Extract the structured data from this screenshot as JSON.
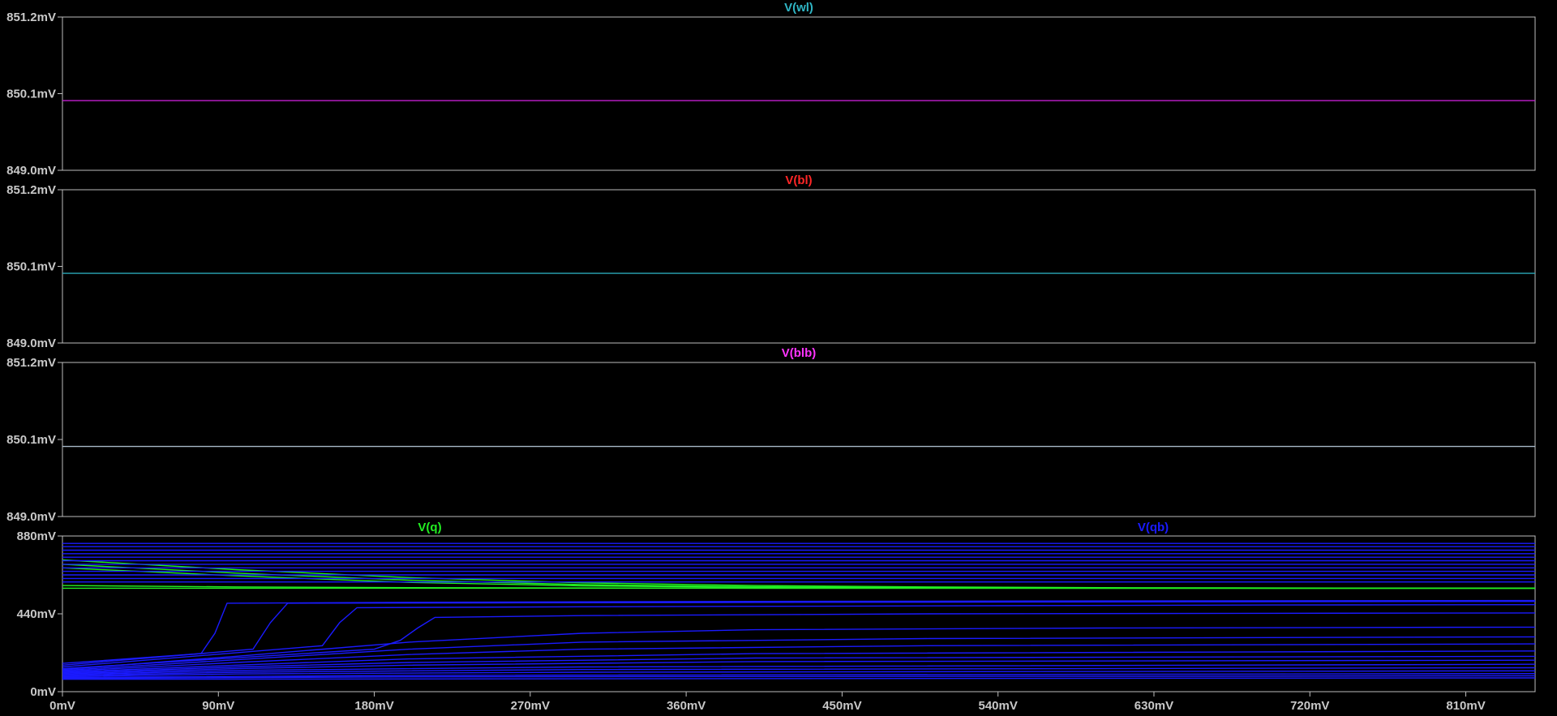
{
  "window": {
    "background": "#000000",
    "frame_color": "#bdbdbd"
  },
  "chart_data": [
    {
      "type": "line",
      "title": "V(wl)",
      "title_color": "#2fb5c4",
      "ylim": [
        849.0,
        851.2
      ],
      "yticks": [
        "851.2mV",
        "850.1mV",
        "849.0mV"
      ],
      "series": [
        {
          "name": "V(wl)",
          "color": "#c41fd0",
          "x": [
            0,
            850
          ],
          "y": [
            850.0,
            850.0
          ]
        }
      ]
    },
    {
      "type": "line",
      "title": "V(bl)",
      "title_color": "#ff2626",
      "ylim": [
        849.0,
        851.2
      ],
      "yticks": [
        "851.2mV",
        "850.1mV",
        "849.0mV"
      ],
      "series": [
        {
          "name": "V(bl)",
          "color": "#2aa8b8",
          "x": [
            0,
            850
          ],
          "y": [
            850.0,
            850.0
          ]
        }
      ]
    },
    {
      "type": "line",
      "title": "V(blb)",
      "title_color": "#ff33ff",
      "ylim": [
        849.0,
        851.2
      ],
      "yticks": [
        "851.2mV",
        "850.1mV",
        "849.0mV"
      ],
      "series": [
        {
          "name": "V(blb)",
          "color": "#a8b8c8",
          "x": [
            0,
            850
          ],
          "y": [
            850.0,
            850.0
          ]
        }
      ]
    },
    {
      "type": "line",
      "ylim": [
        0,
        880
      ],
      "yticks": [
        "880mV",
        "440mV",
        "0mV"
      ],
      "xlim": [
        0,
        850
      ],
      "xticks": [
        "0mV",
        "90mV",
        "180mV",
        "270mV",
        "360mV",
        "450mV",
        "540mV",
        "630mV",
        "720mV",
        "810mV"
      ],
      "legend": [
        {
          "label": "V(q)",
          "color": "#22ee22"
        },
        {
          "label": "V(qb)",
          "color": "#1a1aff"
        }
      ],
      "series": [
        {
          "name": "V(q)",
          "color": "#22ee22",
          "x": [
            0,
            100,
            200,
            300,
            400,
            500,
            600,
            700,
            850
          ],
          "y": [
            745,
            690,
            645,
            615,
            600,
            592,
            588,
            586,
            585
          ]
        },
        {
          "name": "V(q)",
          "color": "#22ee22",
          "x": [
            0,
            100,
            200,
            300,
            400,
            500,
            600,
            700,
            850
          ],
          "y": [
            720,
            670,
            630,
            605,
            593,
            588,
            586,
            585,
            585
          ]
        },
        {
          "name": "V(q)",
          "color": "#22ee22",
          "x": [
            0,
            100,
            200,
            300,
            400,
            500,
            600,
            700,
            850
          ],
          "y": [
            700,
            655,
            618,
            598,
            590,
            586,
            585,
            585,
            585
          ]
        },
        {
          "name": "V(q)",
          "color": "#22ee22",
          "x": [
            0,
            100,
            200,
            300,
            400,
            500,
            850
          ],
          "y": [
            600,
            592,
            588,
            586,
            585,
            585,
            585
          ]
        },
        {
          "name": "V(q)",
          "color": "#22ee22",
          "x": [
            0,
            850
          ],
          "y": [
            585,
            585
          ]
        },
        {
          "name": "V(qb)",
          "color": "#1a1aff",
          "x": [
            0,
            850
          ],
          "y": [
            838,
            838
          ]
        },
        {
          "name": "V(qb)",
          "color": "#1a1aff",
          "x": [
            0,
            850
          ],
          "y": [
            820,
            820
          ]
        },
        {
          "name": "V(qb)",
          "color": "#1a1aff",
          "x": [
            0,
            850
          ],
          "y": [
            800,
            800
          ]
        },
        {
          "name": "V(qb)",
          "color": "#1a1aff",
          "x": [
            0,
            850
          ],
          "y": [
            780,
            780
          ]
        },
        {
          "name": "V(qb)",
          "color": "#1a1aff",
          "x": [
            0,
            850
          ],
          "y": [
            760,
            760
          ]
        },
        {
          "name": "V(qb)",
          "color": "#1a1aff",
          "x": [
            0,
            850
          ],
          "y": [
            740,
            740
          ]
        },
        {
          "name": "V(qb)",
          "color": "#1a1aff",
          "x": [
            0,
            850
          ],
          "y": [
            720,
            720
          ]
        },
        {
          "name": "V(qb)",
          "color": "#1a1aff",
          "x": [
            0,
            850
          ],
          "y": [
            700,
            700
          ]
        },
        {
          "name": "V(qb)",
          "color": "#1a1aff",
          "x": [
            0,
            850
          ],
          "y": [
            680,
            680
          ]
        },
        {
          "name": "V(qb)",
          "color": "#1a1aff",
          "x": [
            0,
            850
          ],
          "y": [
            660,
            660
          ]
        },
        {
          "name": "V(qb)",
          "color": "#1a1aff",
          "x": [
            0,
            850
          ],
          "y": [
            640,
            640
          ]
        },
        {
          "name": "V(qb)",
          "color": "#1a1aff",
          "x": [
            0,
            850
          ],
          "y": [
            620,
            620
          ]
        },
        {
          "name": "V(qb)",
          "color": "#1a1aff",
          "x": [
            0,
            80,
            88,
            95,
            200,
            400,
            600,
            850
          ],
          "y": [
            160,
            215,
            330,
            500,
            505,
            510,
            513,
            515
          ]
        },
        {
          "name": "V(qb)",
          "color": "#1a1aff",
          "x": [
            0,
            110,
            120,
            130,
            250,
            450,
            650,
            850
          ],
          "y": [
            150,
            240,
            390,
            500,
            502,
            505,
            508,
            510
          ]
        },
        {
          "name": "V(qb)",
          "color": "#1a1aff",
          "x": [
            0,
            150,
            160,
            170,
            300,
            500,
            700,
            850
          ],
          "y": [
            140,
            260,
            390,
            475,
            480,
            485,
            490,
            492
          ]
        },
        {
          "name": "V(qb)",
          "color": "#1a1aff",
          "x": [
            0,
            180,
            195,
            205,
            215,
            300,
            500,
            850
          ],
          "y": [
            130,
            240,
            290,
            360,
            420,
            430,
            440,
            445
          ]
        },
        {
          "name": "V(qb)",
          "color": "#1a1aff",
          "x": [
            0,
            100,
            200,
            300,
            400,
            600,
            850
          ],
          "y": [
            125,
            200,
            280,
            330,
            350,
            360,
            365
          ]
        },
        {
          "name": "V(qb)",
          "color": "#1a1aff",
          "x": [
            0,
            100,
            200,
            300,
            500,
            850
          ],
          "y": [
            120,
            180,
            240,
            280,
            300,
            310
          ]
        },
        {
          "name": "V(qb)",
          "color": "#1a1aff",
          "x": [
            0,
            100,
            200,
            300,
            500,
            850
          ],
          "y": [
            115,
            165,
            210,
            240,
            260,
            270
          ]
        },
        {
          "name": "V(qb)",
          "color": "#1a1aff",
          "x": [
            0,
            100,
            200,
            400,
            850
          ],
          "y": [
            110,
            150,
            185,
            215,
            230
          ]
        },
        {
          "name": "V(qb)",
          "color": "#1a1aff",
          "x": [
            0,
            100,
            200,
            400,
            850
          ],
          "y": [
            105,
            140,
            165,
            190,
            200
          ]
        },
        {
          "name": "V(qb)",
          "color": "#1a1aff",
          "x": [
            0,
            100,
            200,
            400,
            850
          ],
          "y": [
            100,
            130,
            150,
            170,
            178
          ]
        },
        {
          "name": "V(qb)",
          "color": "#1a1aff",
          "x": [
            0,
            100,
            300,
            850
          ],
          "y": [
            95,
            120,
            140,
            155
          ]
        },
        {
          "name": "V(qb)",
          "color": "#1a1aff",
          "x": [
            0,
            100,
            300,
            850
          ],
          "y": [
            90,
            110,
            125,
            135
          ]
        },
        {
          "name": "V(qb)",
          "color": "#1a1aff",
          "x": [
            0,
            100,
            300,
            850
          ],
          "y": [
            85,
            100,
            110,
            118
          ]
        },
        {
          "name": "V(qb)",
          "color": "#1a1aff",
          "x": [
            0,
            200,
            850
          ],
          "y": [
            80,
            92,
            102
          ]
        },
        {
          "name": "V(qb)",
          "color": "#1a1aff",
          "x": [
            0,
            200,
            850
          ],
          "y": [
            75,
            84,
            90
          ]
        },
        {
          "name": "V(qb)",
          "color": "#1a1aff",
          "x": [
            0,
            850
          ],
          "y": [
            70,
            78
          ]
        }
      ]
    }
  ]
}
